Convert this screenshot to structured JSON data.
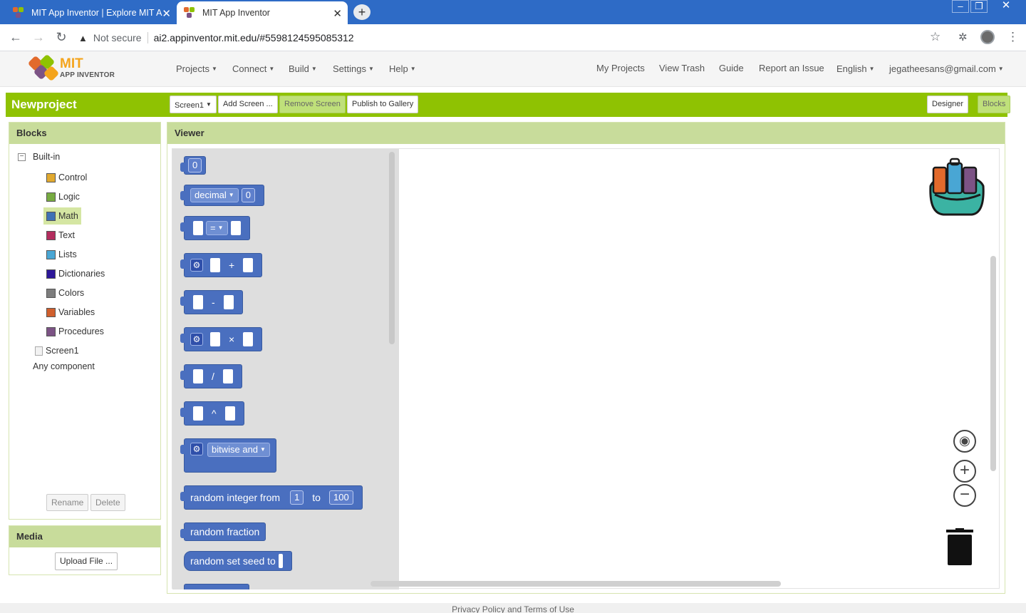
{
  "browser": {
    "tabs": [
      {
        "title": "MIT App Inventor | Explore MIT A",
        "active": false
      },
      {
        "title": "MIT App Inventor",
        "active": true
      }
    ],
    "address": {
      "security": "Not secure",
      "url": "ai2.appinventor.mit.edu/#5598124595085312"
    }
  },
  "appnav": {
    "logo_title": "MIT",
    "logo_subtitle": "APP INVENTOR",
    "left_menus": [
      "Projects",
      "Connect",
      "Build",
      "Settings",
      "Help"
    ],
    "right_links": [
      "My Projects",
      "View Trash",
      "Guide",
      "Report an Issue",
      "English",
      "jegatheesans@gmail.com"
    ]
  },
  "project": {
    "name": "Newproject",
    "screen_select": "Screen1",
    "add_screen": "Add Screen ...",
    "remove_screen": "Remove Screen",
    "publish": "Publish to Gallery",
    "designer": "Designer",
    "blocks": "Blocks"
  },
  "blocks_panel": {
    "title": "Blocks",
    "builtin_label": "Built-in",
    "categories": [
      {
        "label": "Control",
        "color": "#e1a92f"
      },
      {
        "label": "Logic",
        "color": "#77ab41"
      },
      {
        "label": "Math",
        "color": "#3f71b5"
      },
      {
        "label": "Text",
        "color": "#b32d5e"
      },
      {
        "label": "Lists",
        "color": "#49a6d4"
      },
      {
        "label": "Dictionaries",
        "color": "#2d1799"
      },
      {
        "label": "Colors",
        "color": "#7d7d7d"
      },
      {
        "label": "Variables",
        "color": "#d05f2d"
      },
      {
        "label": "Procedures",
        "color": "#7c5385"
      }
    ],
    "screen_item": "Screen1",
    "any_component": "Any component",
    "rename": "Rename",
    "delete": "Delete"
  },
  "media_panel": {
    "title": "Media",
    "upload": "Upload File ..."
  },
  "viewer": {
    "title": "Viewer",
    "blocks": {
      "zero": "0",
      "decimal_dropdown": "decimal",
      "decimal_value": "0",
      "compare_op": "=",
      "plus": "+",
      "minus": "-",
      "times": "×",
      "divide": "/",
      "power": "^",
      "bitwise": "bitwise and",
      "random_int_label": "random integer from",
      "random_int_from": "1",
      "random_int_to_label": "to",
      "random_int_to": "100",
      "random_fraction": "random fraction",
      "random_seed": "random set seed  to"
    }
  },
  "footer": {
    "text": "Privacy Policy and Terms of Use"
  }
}
